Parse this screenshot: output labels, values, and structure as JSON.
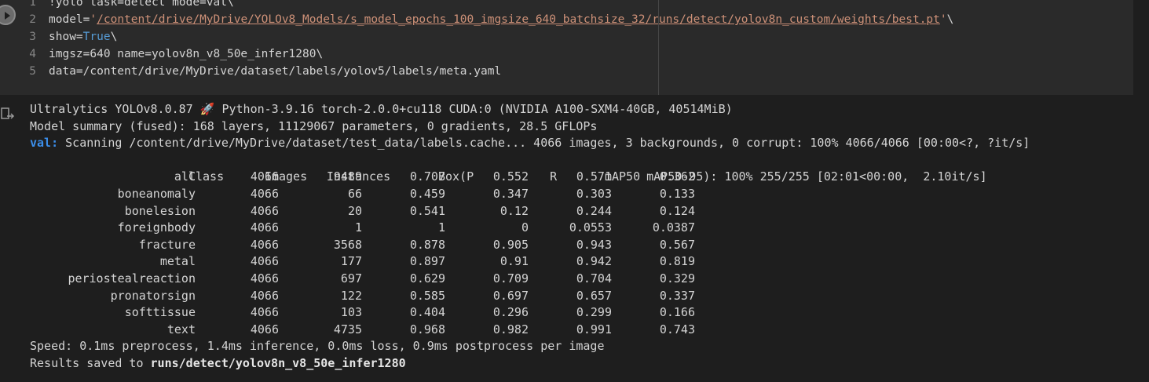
{
  "code_cell": {
    "lines": [
      {
        "num": "1",
        "parts": [
          {
            "t": "!yolo task=detect mode=val\\",
            "c": ""
          }
        ]
      },
      {
        "num": "2",
        "parts": [
          {
            "t": "model=",
            "c": ""
          },
          {
            "t": "'",
            "c": "str"
          },
          {
            "t": "/content/drive/MyDrive/YOLOv8_Models/s_model_epochs_100_imgsize_640_batchsize_32/runs/detect/yolov8n_custom/weights/best.pt",
            "c": "str-link"
          },
          {
            "t": "'",
            "c": "str"
          },
          {
            "t": "\\",
            "c": ""
          }
        ]
      },
      {
        "num": "3",
        "parts": [
          {
            "t": "show=",
            "c": ""
          },
          {
            "t": "True",
            "c": "kw"
          },
          {
            "t": "\\",
            "c": ""
          }
        ]
      },
      {
        "num": "4",
        "parts": [
          {
            "t": "imgsz=640 name=yolov8n_v8_50e_infer1280\\",
            "c": ""
          }
        ]
      },
      {
        "num": "5",
        "parts": [
          {
            "t": "data=/content/drive/MyDrive/dataset/labels/yolov5/labels/meta.yaml",
            "c": ""
          }
        ]
      }
    ]
  },
  "output": {
    "header_line_1_prefix": "Ultralytics YOLOv8.0.87 ",
    "rocket": "🚀",
    "header_line_1_suffix": " Python-3.9.16 torch-2.0.0+cu118 CUDA:0 (NVIDIA A100-SXM4-40GB, 40514MiB)",
    "header_line_2": "Model summary (fused): 168 layers, 11129067 parameters, 0 gradients, 28.5 GFLOPs",
    "val_tag": "val:",
    "val_line": " Scanning /content/drive/MyDrive/dataset/test_data/labels.cache... 4066 images, 3 backgrounds, 0 corrupt: 100% 4066/4066 [00:00<?, ?it/s]",
    "table_header": [
      "Class",
      "Images",
      "Instances",
      "Box(P",
      "R",
      "mAP50",
      "mAP50-95): 100% 255/255 [02:01<00:00,  2.10it/s]"
    ],
    "rows": [
      [
        "all",
        "4066",
        "9489",
        "0.707",
        "0.552",
        "0.571",
        "0.362"
      ],
      [
        "boneanomaly",
        "4066",
        "66",
        "0.459",
        "0.347",
        "0.303",
        "0.133"
      ],
      [
        "bonelesion",
        "4066",
        "20",
        "0.541",
        "0.12",
        "0.244",
        "0.124"
      ],
      [
        "foreignbody",
        "4066",
        "1",
        "1",
        "0",
        "0.0553",
        "0.0387"
      ],
      [
        "fracture",
        "4066",
        "3568",
        "0.878",
        "0.905",
        "0.943",
        "0.567"
      ],
      [
        "metal",
        "4066",
        "177",
        "0.897",
        "0.91",
        "0.942",
        "0.819"
      ],
      [
        "periostealreaction",
        "4066",
        "697",
        "0.629",
        "0.709",
        "0.704",
        "0.329"
      ],
      [
        "pronatorsign",
        "4066",
        "122",
        "0.585",
        "0.697",
        "0.657",
        "0.337"
      ],
      [
        "softtissue",
        "4066",
        "103",
        "0.404",
        "0.296",
        "0.299",
        "0.166"
      ],
      [
        "text",
        "4066",
        "4735",
        "0.968",
        "0.982",
        "0.991",
        "0.743"
      ]
    ],
    "speed_line": "Speed: 0.1ms preprocess, 1.4ms inference, 0.0ms loss, 0.9ms postprocess per image",
    "results_prefix": "Results saved to ",
    "results_path": "runs/detect/yolov8n_v8_50e_infer1280"
  },
  "colors": {
    "background": "#1e1e1e",
    "code_background": "#2a2a2a",
    "string": "#ce9178",
    "keyword": "#569cd6",
    "val_tag": "#3b8eea"
  },
  "icons": {
    "run": "run-cell-icon",
    "output": "output-toggle-icon"
  }
}
